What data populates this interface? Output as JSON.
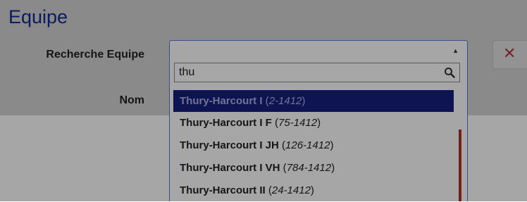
{
  "page": {
    "title": "Equipe"
  },
  "form": {
    "search_label": "Recherche Equipe",
    "name_label": "Nom",
    "close_glyph": "✕"
  },
  "select": {
    "search_value": "thu",
    "search_icon": "search-icon",
    "options": [
      {
        "name": "Thury-Harcourt I",
        "code": "2-1412",
        "selected": true
      },
      {
        "name": "Thury-Harcourt I F",
        "code": "75-1412",
        "selected": false
      },
      {
        "name": "Thury-Harcourt I JH",
        "code": "126-1412",
        "selected": false
      },
      {
        "name": "Thury-Harcourt I VH",
        "code": "784-1412",
        "selected": false
      },
      {
        "name": "Thury-Harcourt II",
        "code": "24-1412",
        "selected": false
      }
    ]
  },
  "colors": {
    "title": "#0f2d8a",
    "selected_bg": "#15207d",
    "scrollbar": "#b5311f",
    "close_icon": "#b33a3a"
  }
}
